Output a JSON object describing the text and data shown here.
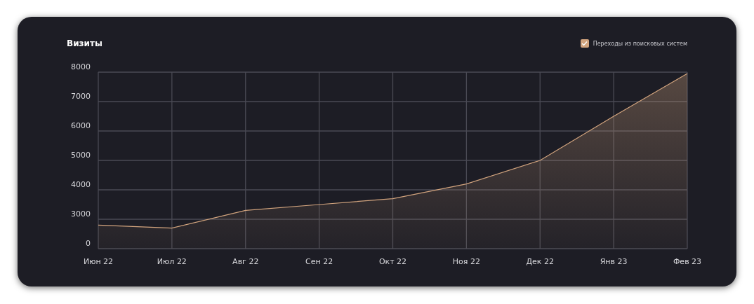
{
  "card": {
    "title": "Визиты",
    "legend": {
      "checked": true
    },
    "chart_data": {
      "type": "area",
      "grid": true,
      "categories": [
        "Июн 22",
        "Июл 22",
        "Авг 22",
        "Сен 22",
        "Окт 22",
        "Ноя 22",
        "Дек 22",
        "Янв 23",
        "Фев 23"
      ],
      "series": [
        {
          "name": "Переходы из поисковых систем",
          "color": "#d2a47e",
          "values": [
            2800,
            2700,
            3300,
            3500,
            3700,
            4200,
            5000,
            6500,
            7950
          ]
        }
      ],
      "ylim": [
        2000,
        8000
      ],
      "yticks": [
        3000,
        4000,
        5000,
        6000,
        7000,
        8000
      ]
    },
    "axis_bottom_label": "0"
  }
}
